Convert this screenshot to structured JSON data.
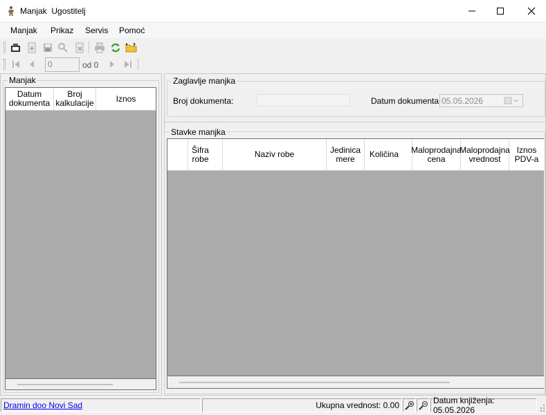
{
  "window": {
    "title": "Manjak  Ugostitelj",
    "app_icon": "figure-icon"
  },
  "menu": [
    "Manjak",
    "Prikaz",
    "Servis",
    "Pomoć"
  ],
  "toolbar": {
    "icons": [
      "new-document-icon",
      "add-document-icon",
      "save-icon",
      "search-key-icon",
      "delete-document-icon",
      "print-icon",
      "refresh-icon",
      "open-folder-icon"
    ]
  },
  "navigator": {
    "position_value": "0",
    "of_label": "od 0"
  },
  "left_panel": {
    "title": "Manjak",
    "columns": [
      "Datum dokumenta",
      "Broj kalkulacije",
      "Iznos"
    ]
  },
  "header_panel": {
    "title": "Zaglavlje manjka",
    "doc_number_label": "Broj dokumenta:",
    "doc_number_value": "",
    "doc_date_label": "Datum dokumenta:",
    "doc_date_value": "05.05.2026"
  },
  "items_panel": {
    "title": "Stavke manjka",
    "columns": [
      "Šifra robe",
      "Naziv robe",
      "Jedinica mere",
      "Količina",
      "Maloprodajna cena",
      "Maloprodajna vrednost",
      "Iznos PDV-a"
    ]
  },
  "status": {
    "company_link": "Dramin doo Novi Sad",
    "total_label": "Ukupna vrednost: 0.00",
    "posting_date": "Datum knjiženja: 05.05.2026"
  }
}
